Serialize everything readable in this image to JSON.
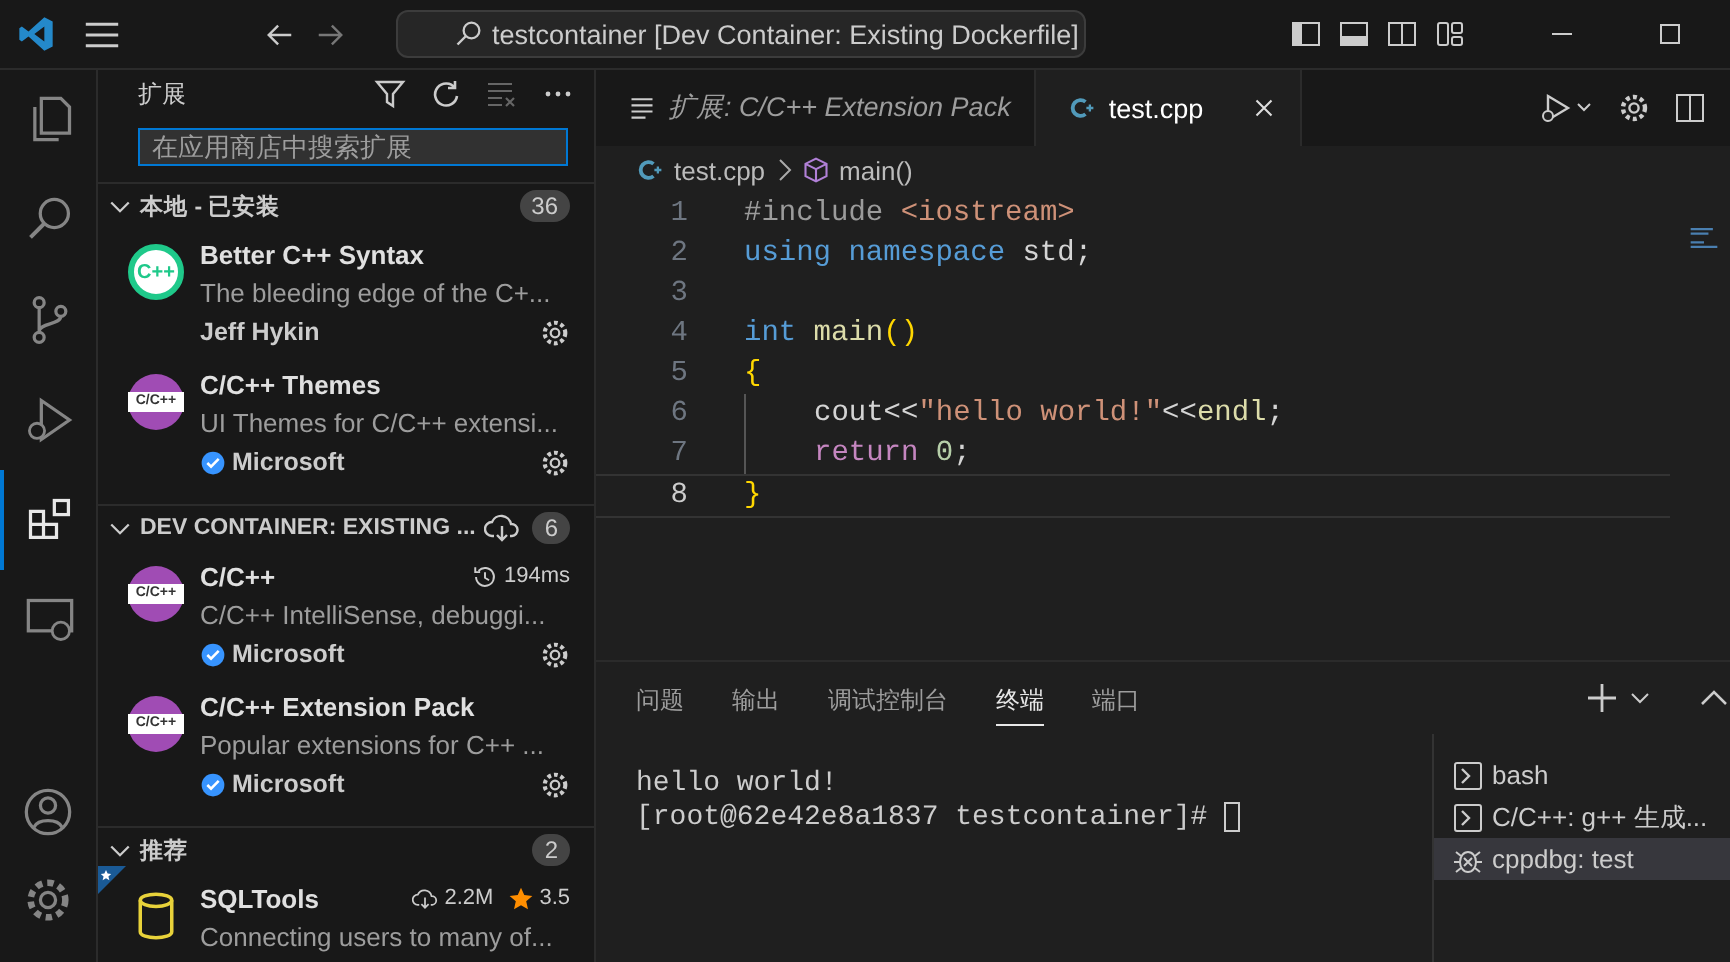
{
  "window": {
    "title": "testcontainer [Dev Container: Existing Dockerfile]"
  },
  "activity_bar": [
    {
      "kind": "files",
      "selected": false
    },
    {
      "kind": "search",
      "selected": false
    },
    {
      "kind": "source-control",
      "selected": false
    },
    {
      "kind": "run",
      "selected": false
    },
    {
      "kind": "extensions",
      "selected": true
    },
    {
      "kind": "remote",
      "selected": false
    }
  ],
  "sidebar": {
    "title": "扩展",
    "search": {
      "placeholder": "在应用商店中搜索扩展"
    },
    "sections": [
      {
        "title": "本地 - 已安装",
        "count": "36",
        "expanded": true,
        "items": [
          {
            "kind": "green-logo",
            "logo_text": "C++",
            "name": "Better C++ Syntax",
            "description": "The bleeding edge of the C+...",
            "publisher": "Jeff Hykin"
          },
          {
            "kind": "purple-logo",
            "logo_text": "C/C++",
            "name": "C/C++ Themes",
            "description": "UI Themes for C/C++ extensi...",
            "publisher": "Microsoft",
            "verified": true
          }
        ]
      },
      {
        "title": "DEV CONTAINER: EXISTING ...",
        "count": "6",
        "expanded": true,
        "cloud": true,
        "items": [
          {
            "kind": "purple-logo",
            "logo_text": "C/C++",
            "name": "C/C++",
            "time": "194ms",
            "description": "C/C++ IntelliSense, debuggi...",
            "publisher": "Microsoft",
            "verified": true
          },
          {
            "kind": "purple-logo",
            "logo_text": "C/C++",
            "name": "C/C++ Extension Pack",
            "description": "Popular extensions for C++ ...",
            "publisher": "Microsoft",
            "verified": true
          }
        ]
      },
      {
        "title": "推荐",
        "count": "2",
        "expanded": true,
        "items": [
          {
            "kind": "database",
            "recommended": true,
            "name": "SQLTools",
            "downloads": "2.2M",
            "rating": "3.5",
            "description": "Connecting users to many of..."
          }
        ]
      }
    ]
  },
  "editor": {
    "tabs": [
      {
        "label": "扩展: C/C++ Extension Pack",
        "kind": "preview",
        "selected": false
      },
      {
        "label": "test.cpp",
        "kind": "cpp",
        "selected": true
      }
    ],
    "breadcrumb": [
      "test.cpp",
      "main()"
    ],
    "lines": [
      {
        "number": "1",
        "tokens": [
          {
            "kind": "pre",
            "text": "#include"
          },
          {
            "kind": "str",
            "text": " <iostream>"
          }
        ]
      },
      {
        "number": "2",
        "tokens": [
          {
            "kind": "kw",
            "text": "using namespace"
          },
          {
            "kind": "plain",
            "text": " std;"
          }
        ]
      },
      {
        "number": "3"
      },
      {
        "number": "4",
        "tokens": [
          {
            "kind": "kw",
            "text": "int"
          },
          {
            "kind": "fn",
            "text": " main"
          },
          {
            "kind": "br",
            "text": "()"
          }
        ]
      },
      {
        "number": "5",
        "tokens": [
          {
            "kind": "br",
            "text": "{"
          }
        ]
      },
      {
        "number": "6",
        "indented": true,
        "tokens": [
          {
            "kind": "var",
            "text": "cout<<"
          },
          {
            "kind": "str",
            "text": "\"hello world!\""
          },
          {
            "kind": "plain",
            "text": "<<"
          },
          {
            "kind": "fn",
            "text": "endl"
          },
          {
            "kind": "plain",
            "text": ";"
          }
        ]
      },
      {
        "number": "7",
        "indented": true,
        "tokens": [
          {
            "kind": "ctl",
            "text": "return"
          },
          {
            "kind": "num",
            "text": " 0"
          },
          {
            "kind": "plain",
            "text": ";"
          }
        ]
      },
      {
        "number": "8",
        "tokens": [
          {
            "kind": "br",
            "text": "}"
          }
        ]
      }
    ]
  },
  "panel": {
    "tabs": [
      {
        "label": "问题",
        "selected": false
      },
      {
        "label": "输出",
        "selected": false
      },
      {
        "label": "调试控制台",
        "selected": false
      },
      {
        "label": "终端",
        "selected": true
      },
      {
        "label": "端口",
        "selected": false
      }
    ],
    "terminal_lines": [
      "hello world!",
      "[root@62e42e8a1837 testcontainer]#"
    ],
    "terminals": [
      {
        "kind": "shell",
        "label": "bash",
        "selected": false
      },
      {
        "kind": "shell",
        "label": "C/C++: g++ 生成...",
        "selected": false
      },
      {
        "kind": "debug",
        "label": "cppdbg: test",
        "selected": true
      }
    ]
  }
}
